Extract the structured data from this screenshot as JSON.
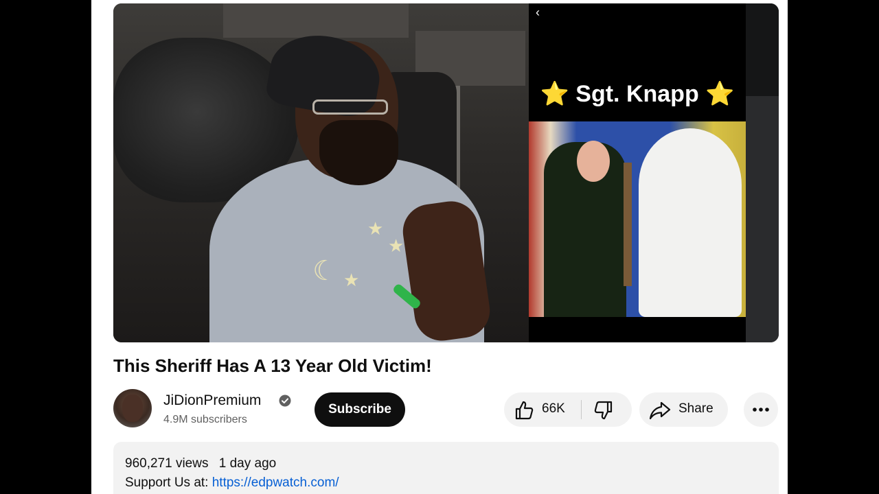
{
  "video": {
    "overlay": {
      "back_glyph": "‹",
      "banner_text": "⭐ Sgt. Knapp ⭐"
    }
  },
  "title": "This Sheriff Has A 13 Year Old Victim!",
  "channel": {
    "name": "JiDionPremium",
    "verified_icon": "verified-check-icon",
    "subscribers": "4.9M subscribers",
    "subscribe_label": "Subscribe"
  },
  "actions": {
    "like_count": "66K",
    "like_icon": "thumbs-up-icon",
    "dislike_icon": "thumbs-down-icon",
    "share_label": "Share",
    "share_icon": "share-arrow-icon",
    "more_icon": "more-horizontal-icon"
  },
  "description": {
    "views": "960,271 views",
    "age": "1 day ago",
    "support_prefix": "Support Us at: ",
    "link_text": "https://edpwatch.com/"
  },
  "colors": {
    "link": "#065fd4",
    "subscribe_bg": "#0f0f0f",
    "pill_bg": "#f2f2f2",
    "wristband": "#2fb44a"
  }
}
